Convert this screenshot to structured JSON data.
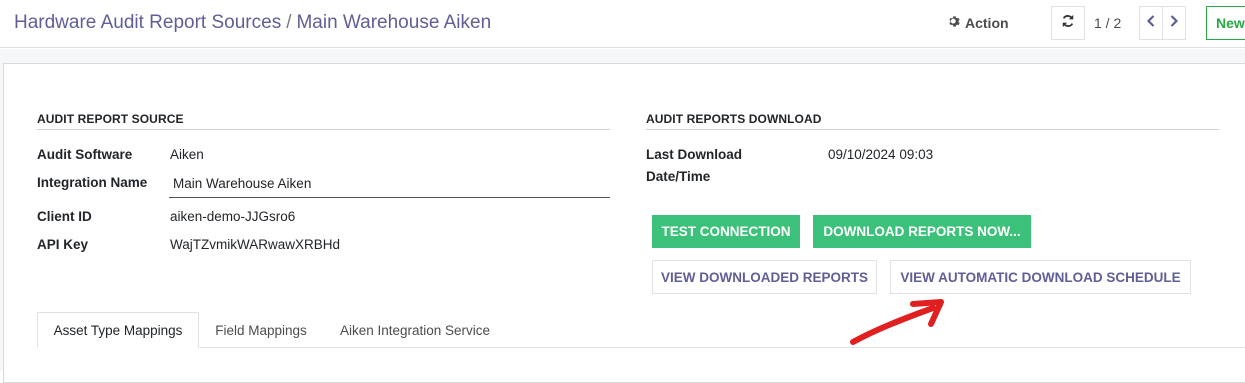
{
  "breadcrumb": {
    "parent": "Hardware Audit Report Sources",
    "separator": "/",
    "current": "Main Warehouse Aiken"
  },
  "toolbar": {
    "action_label": "Action",
    "pager_value": "1 / 2",
    "new_label": "New"
  },
  "audit_source": {
    "title": "AUDIT REPORT SOURCE",
    "fields": [
      {
        "label": "Audit Software",
        "value": "Aiken"
      },
      {
        "label": "Integration Name",
        "value": "Main Warehouse Aiken"
      },
      {
        "label": "Client ID",
        "value": "aiken-demo-JJGsro6"
      },
      {
        "label": "API Key",
        "value": "WajTZvmikWARwawXRBHd"
      }
    ]
  },
  "audit_download": {
    "title": "AUDIT REPORTS DOWNLOAD",
    "last_download_label_line1": "Last Download",
    "last_download_label_line2": "Date/Time",
    "last_download_value": "09/10/2024 09:03"
  },
  "buttons": {
    "test_connection": "TEST CONNECTION",
    "download_now": "DOWNLOAD REPORTS NOW...",
    "view_downloaded": "VIEW DOWNLOADED REPORTS",
    "view_schedule": "VIEW AUTOMATIC DOWNLOAD SCHEDULE"
  },
  "tabs": [
    {
      "label": "Asset Type Mappings",
      "active": true
    },
    {
      "label": "Field Mappings",
      "active": false
    },
    {
      "label": "Aiken Integration Service",
      "active": false
    }
  ],
  "colors": {
    "accent": "#5f5e97",
    "success": "#3cc17a",
    "annotation": "#e02020"
  }
}
